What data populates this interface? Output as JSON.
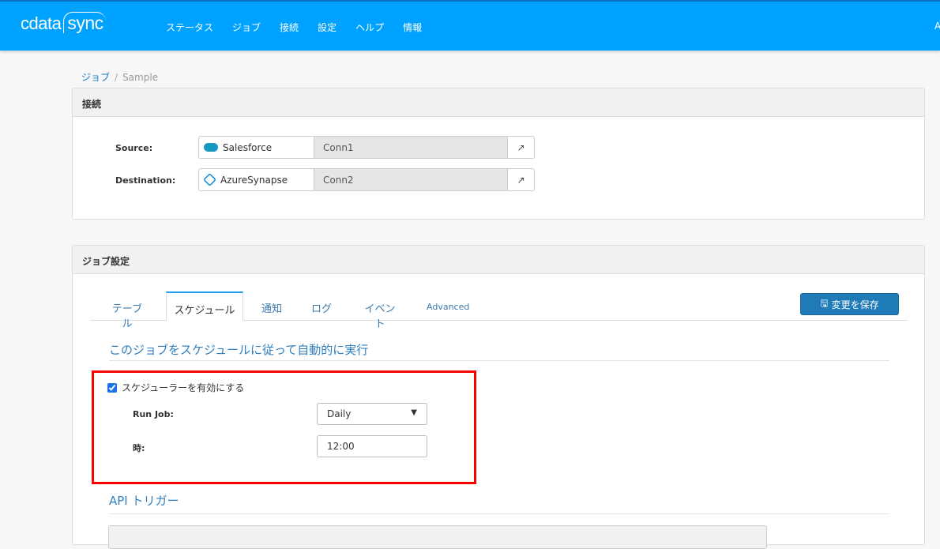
{
  "header": {
    "logo_left": "cdata",
    "logo_right": "sync",
    "nav": [
      "ステータス",
      "ジョブ",
      "接続",
      "設定",
      "ヘルプ",
      "情報"
    ],
    "user": "A"
  },
  "breadcrumb": {
    "parent": "ジョブ",
    "separator": "/",
    "current": "Sample"
  },
  "connections": {
    "title": "接続",
    "source_label": "Source:",
    "source_type": "Salesforce",
    "source_conn": "Conn1",
    "dest_label": "Destination:",
    "dest_type": "AzureSynapse",
    "dest_conn": "Conn2"
  },
  "job": {
    "title": "ジョブ設定",
    "tabs": [
      "テーブル",
      "スケジュール",
      "通知",
      "ログ",
      "イベント",
      "Advanced"
    ],
    "active_tab": "スケジュール",
    "save_label": "変更を保存",
    "schedule_heading": "このジョブをスケジュールに従って自動的に実行",
    "enable_label": "スケジューラーを有効にする",
    "enabled": true,
    "run_job_label": "Run Job:",
    "run_job_value": "Daily",
    "time_label": "時:",
    "time_value": "12:00",
    "api_heading": "API トリガー"
  }
}
